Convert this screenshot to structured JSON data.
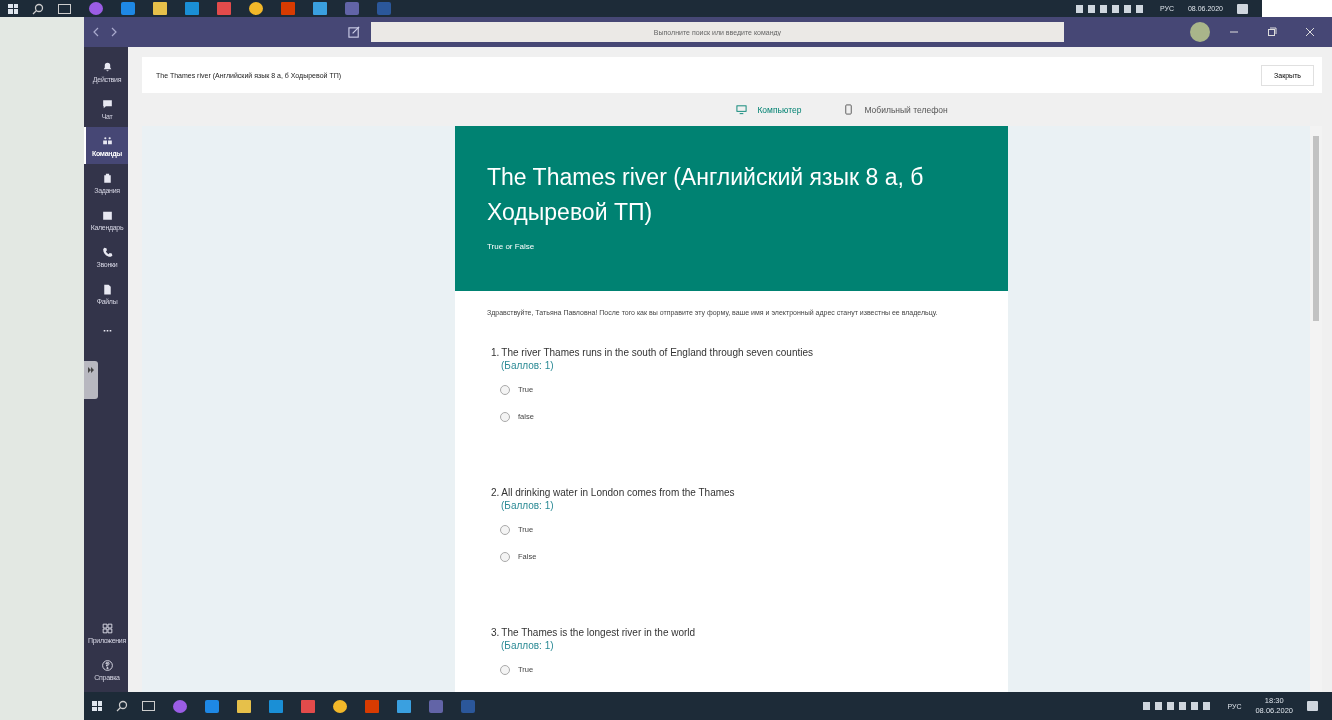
{
  "taskbar_top": {
    "tray": {
      "language": "РУС",
      "date": "08.06.2020"
    }
  },
  "window": {
    "search": {
      "placeholder": "Выполните поиск или введите команду"
    }
  },
  "rail": {
    "items": [
      {
        "kind": "activity",
        "label": "Действия",
        "selected": false
      },
      {
        "kind": "chat",
        "label": "Чат",
        "selected": false
      },
      {
        "kind": "teams",
        "label": "Команды",
        "selected": true
      },
      {
        "kind": "assignments",
        "label": "Задания",
        "selected": false
      },
      {
        "kind": "calendar",
        "label": "Календарь",
        "selected": false
      },
      {
        "kind": "calls",
        "label": "Звонки",
        "selected": false
      },
      {
        "kind": "files",
        "label": "Файлы",
        "selected": false
      },
      {
        "kind": "more",
        "selected": false
      }
    ],
    "bottom_items": [
      {
        "kind": "apps",
        "label": "Приложения",
        "selected": false
      },
      {
        "kind": "help",
        "label": "Справка",
        "selected": false
      }
    ]
  },
  "tab_header": {
    "title": "The Thames river (Английский язык 8 а, б Ходыревой ТП)",
    "close_button": "Закрыть"
  },
  "preview_tabs": [
    {
      "kind": "computer",
      "label": "Компьютер",
      "selected": true
    },
    {
      "kind": "phone",
      "label": "Мобильный телефон",
      "selected": false
    }
  ],
  "form": {
    "title": "The Thames river (Английский язык 8 а, б Ходыревой ТП)",
    "subtitle": "True   or False",
    "intro": "Здравствуйте, Татьяна Павловна! После того как вы отправите эту форму, ваше имя и электронный адрес станут известны ее владельцу.",
    "questions": [
      {
        "number": "1.",
        "text": "The river Thames runs in the south of England through seven counties",
        "points": "(Баллов: 1)",
        "options": [
          {
            "label": "True",
            "selected": false
          },
          {
            "label": "false",
            "selected": false
          }
        ]
      },
      {
        "number": "2.",
        "text": "All drinking water in London comes from the Thames",
        "points": "(Баллов: 1)",
        "options": [
          {
            "label": "True",
            "selected": false
          },
          {
            "label": "False",
            "selected": false
          }
        ]
      },
      {
        "number": "3.",
        "text": "The Thames is the longest river in the world",
        "points": "(Баллов: 1)",
        "options": [
          {
            "label": "True",
            "selected": false
          }
        ]
      }
    ]
  },
  "taskbar_bottom": {
    "tray": {
      "language": "РУС",
      "time": "18:30",
      "date": "08.06.2020"
    }
  }
}
